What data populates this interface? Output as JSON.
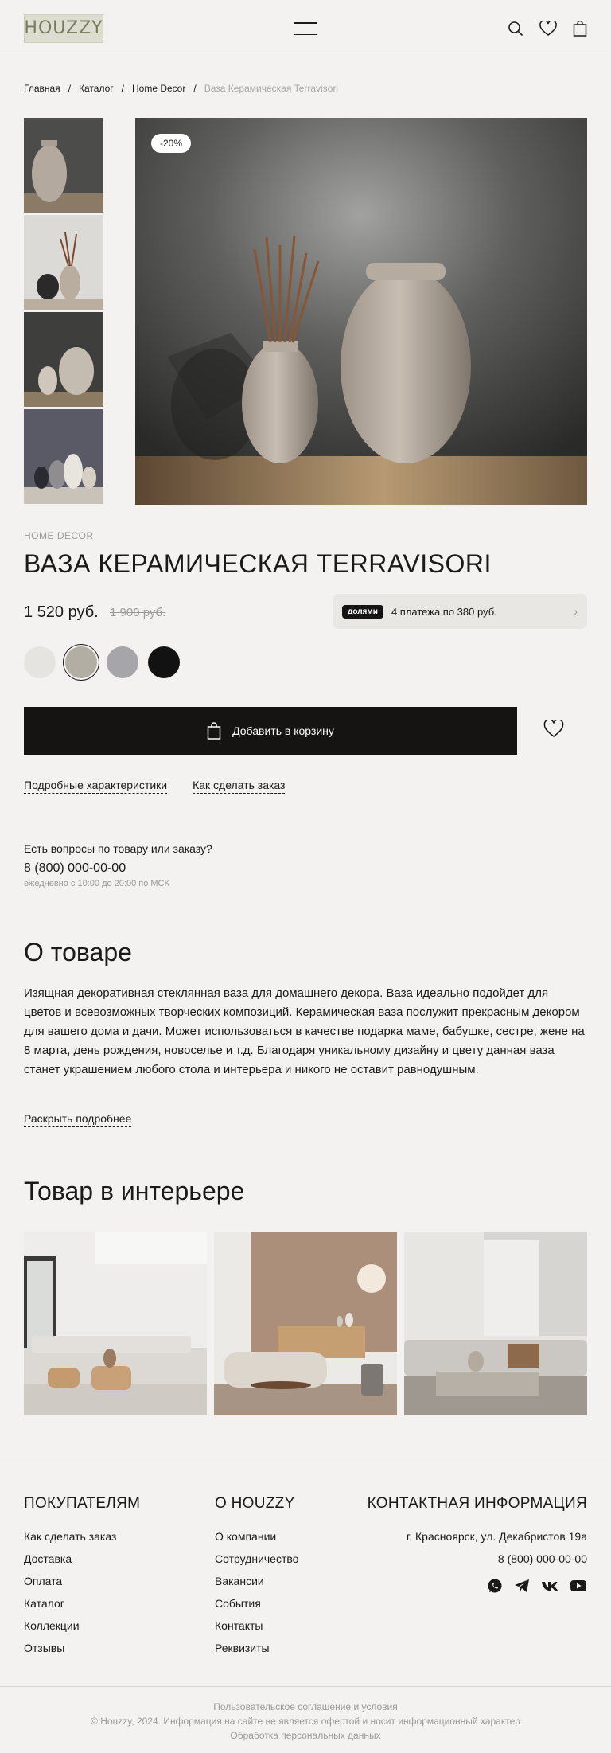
{
  "header": {
    "logo": "HOUZZY",
    "icons": [
      "menu-icon",
      "search-icon",
      "heart-icon",
      "bag-icon"
    ]
  },
  "breadcrumbs": {
    "items": [
      "Главная",
      "Каталог",
      "Home Decor"
    ],
    "current": "Ваза Керамическая Terravisori",
    "separator": "/"
  },
  "gallery": {
    "discount_badge": "-20%",
    "thumbnails": 4
  },
  "product": {
    "category": "HOME DECOR",
    "title": "ВАЗА КЕРАМИЧЕСКАЯ TERRAVISORI",
    "price": "1 520 руб.",
    "old_price": "1 900 руб.",
    "installments_logo": "долями",
    "installments_text": "4 платежа по 380 руб.",
    "colors": [
      "#e6e4e0",
      "#b3aea3",
      "#a6a6aa",
      "#121212"
    ],
    "selected_color_index": 1,
    "add_to_cart": "Добавить в корзину",
    "link_specs": "Подробные характеристики",
    "link_order": "Как сделать заказ"
  },
  "contact": {
    "question": "Есть вопросы по товару или заказу?",
    "phone": "8 (800) 000-00-00",
    "hours": "ежедневно с 10:00 до 20:00 по МСК"
  },
  "about": {
    "heading": "О товаре",
    "text": "Изящная декоративная стеклянная ваза для домашнего декора. Ваза идеально подойдет для цветов и всевозможных творческих композиций. Керамическая ваза послужит прекрасным декором для вашего дома и дачи. Может использоваться в качестве подарка маме, бабушке, сестре, жене на 8 марта, день рождения, новоселье и т.д. Благодаря уникальному дизайну и цвету данная ваза станет украшением любого стола и интерьера и никого не оставит равнодушным.",
    "more": "Раскрыть подробнее"
  },
  "interior": {
    "heading": "Товар в интерьере"
  },
  "footer": {
    "col1": {
      "title": "ПОКУПАТЕЛЯМ",
      "items": [
        "Как сделать заказ",
        "Доставка",
        "Оплата",
        "Каталог",
        "Коллекции",
        "Отзывы"
      ]
    },
    "col2": {
      "title": "О HOUZZY",
      "items": [
        "О компании",
        "Сотрудничество",
        "Вакансии",
        "События",
        "Контакты",
        "Реквизиты"
      ]
    },
    "col3": {
      "title": "КОНТАКТНАЯ ИНФОРМАЦИЯ",
      "address": "г. Красноярск, ул. Декабристов 19а",
      "phone": "8 (800) 000-00-00",
      "social": [
        "whatsapp-icon",
        "telegram-icon",
        "vk-icon",
        "youtube-icon"
      ]
    },
    "bottom": {
      "terms": "Пользовательское соглашение и условия",
      "copyright": "© Houzzy, 2024. Информация на сайте не является офертой и носит информационный характер",
      "privacy": "Обработка персональных данных"
    }
  }
}
